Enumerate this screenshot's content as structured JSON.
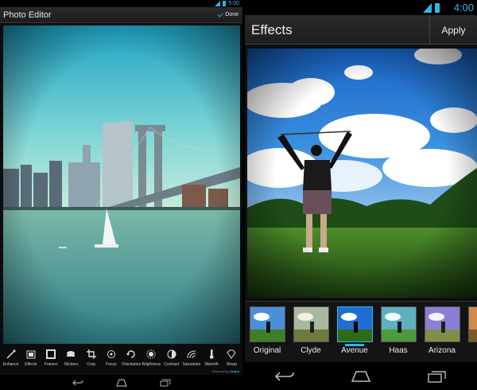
{
  "left": {
    "status_time": "5:00",
    "title": "Photo Editor",
    "done_label": "Done",
    "tools": [
      {
        "label": "Enhance",
        "icon": "wand-icon"
      },
      {
        "label": "Effects",
        "icon": "effects-icon"
      },
      {
        "label": "Frames",
        "icon": "frame-icon"
      },
      {
        "label": "Stickers",
        "icon": "sticker-icon"
      },
      {
        "label": "Crop",
        "icon": "crop-icon"
      },
      {
        "label": "Focus",
        "icon": "focus-icon"
      },
      {
        "label": "Orientation",
        "icon": "orientation-icon"
      },
      {
        "label": "Brightness",
        "icon": "brightness-icon"
      },
      {
        "label": "Contrast",
        "icon": "contrast-icon"
      },
      {
        "label": "Saturation",
        "icon": "saturation-icon"
      },
      {
        "label": "Warmth",
        "icon": "thermometer-icon"
      },
      {
        "label": "Sharp",
        "icon": "diamond-icon"
      }
    ],
    "powered_prefix": "Powered by",
    "powered_brand": "Aviary"
  },
  "right": {
    "status_time": "4:00",
    "title": "Effects",
    "apply_label": "Apply",
    "effects": [
      {
        "label": "Original",
        "selected": false
      },
      {
        "label": "Clyde",
        "selected": false
      },
      {
        "label": "Avenue",
        "selected": true
      },
      {
        "label": "Haas",
        "selected": false
      },
      {
        "label": "Arizona",
        "selected": false
      }
    ]
  },
  "colors": {
    "accent": "#33b5e5"
  }
}
